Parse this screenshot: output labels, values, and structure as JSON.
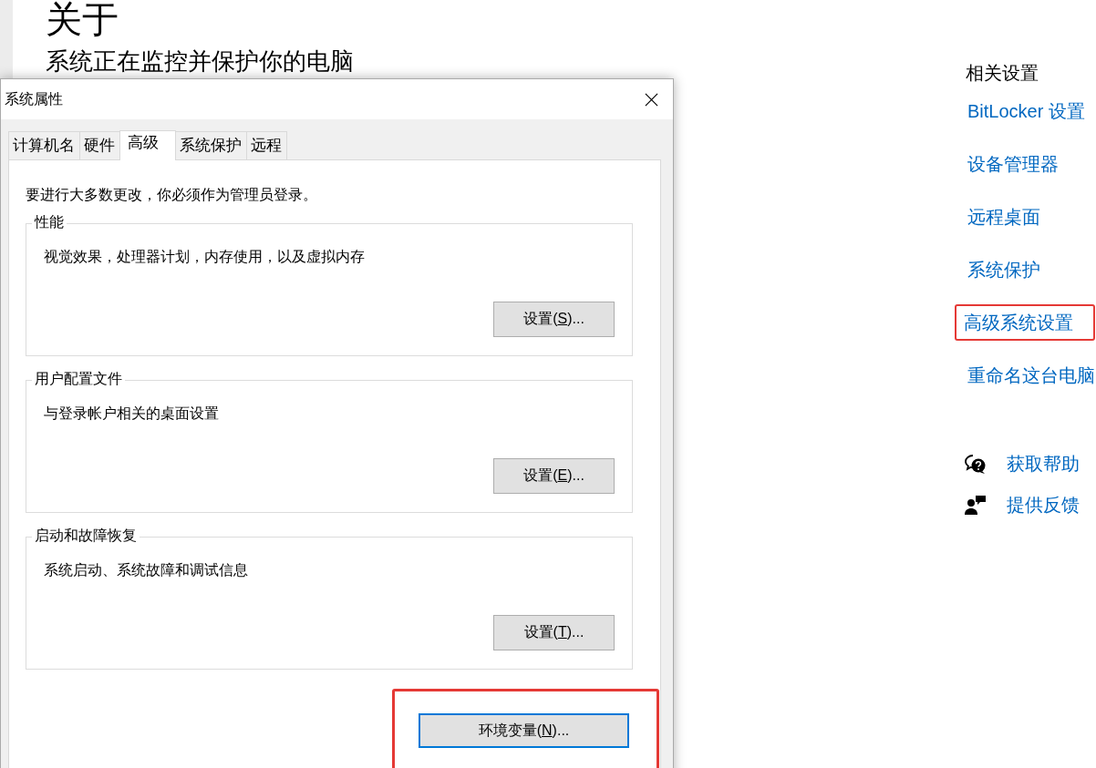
{
  "page": {
    "title": "关于",
    "subtitle": "系统正在监控并保护你的电脑"
  },
  "dialog": {
    "title": "系统属性",
    "tabs": [
      {
        "label": "计算机名",
        "selected": false
      },
      {
        "label": "硬件",
        "selected": false
      },
      {
        "label": "高级",
        "selected": true
      },
      {
        "label": "系统保护",
        "selected": false
      },
      {
        "label": "远程",
        "selected": false
      }
    ],
    "notice": "要进行大多数更改，你必须作为管理员登录。",
    "groups": [
      {
        "title": "性能",
        "description": "视觉效果，处理器计划，内存使用，以及虚拟内存",
        "button": {
          "before": "设置(",
          "key": "S",
          "after": ")..."
        }
      },
      {
        "title": "用户配置文件",
        "description": "与登录帐户相关的桌面设置",
        "button": {
          "before": "设置(",
          "key": "E",
          "after": ")..."
        }
      },
      {
        "title": "启动和故障恢复",
        "description": "系统启动、系统故障和调试信息",
        "button": {
          "before": "设置(",
          "key": "T",
          "after": ")..."
        }
      }
    ],
    "env_button": {
      "before": "环境变量(",
      "key": "N",
      "after": ")...",
      "highlighted": true
    }
  },
  "related": {
    "heading": "相关设置",
    "links": [
      {
        "label": "BitLocker 设置",
        "highlighted": false
      },
      {
        "label": "设备管理器",
        "highlighted": false
      },
      {
        "label": "远程桌面",
        "highlighted": false
      },
      {
        "label": "系统保护",
        "highlighted": false
      },
      {
        "label": "高级系统设置",
        "highlighted": true
      },
      {
        "label": "重命名这台电脑",
        "highlighted": false
      }
    ],
    "help": [
      {
        "kind": "help",
        "label": "获取帮助"
      },
      {
        "kind": "feedback",
        "label": "提供反馈"
      }
    ]
  }
}
